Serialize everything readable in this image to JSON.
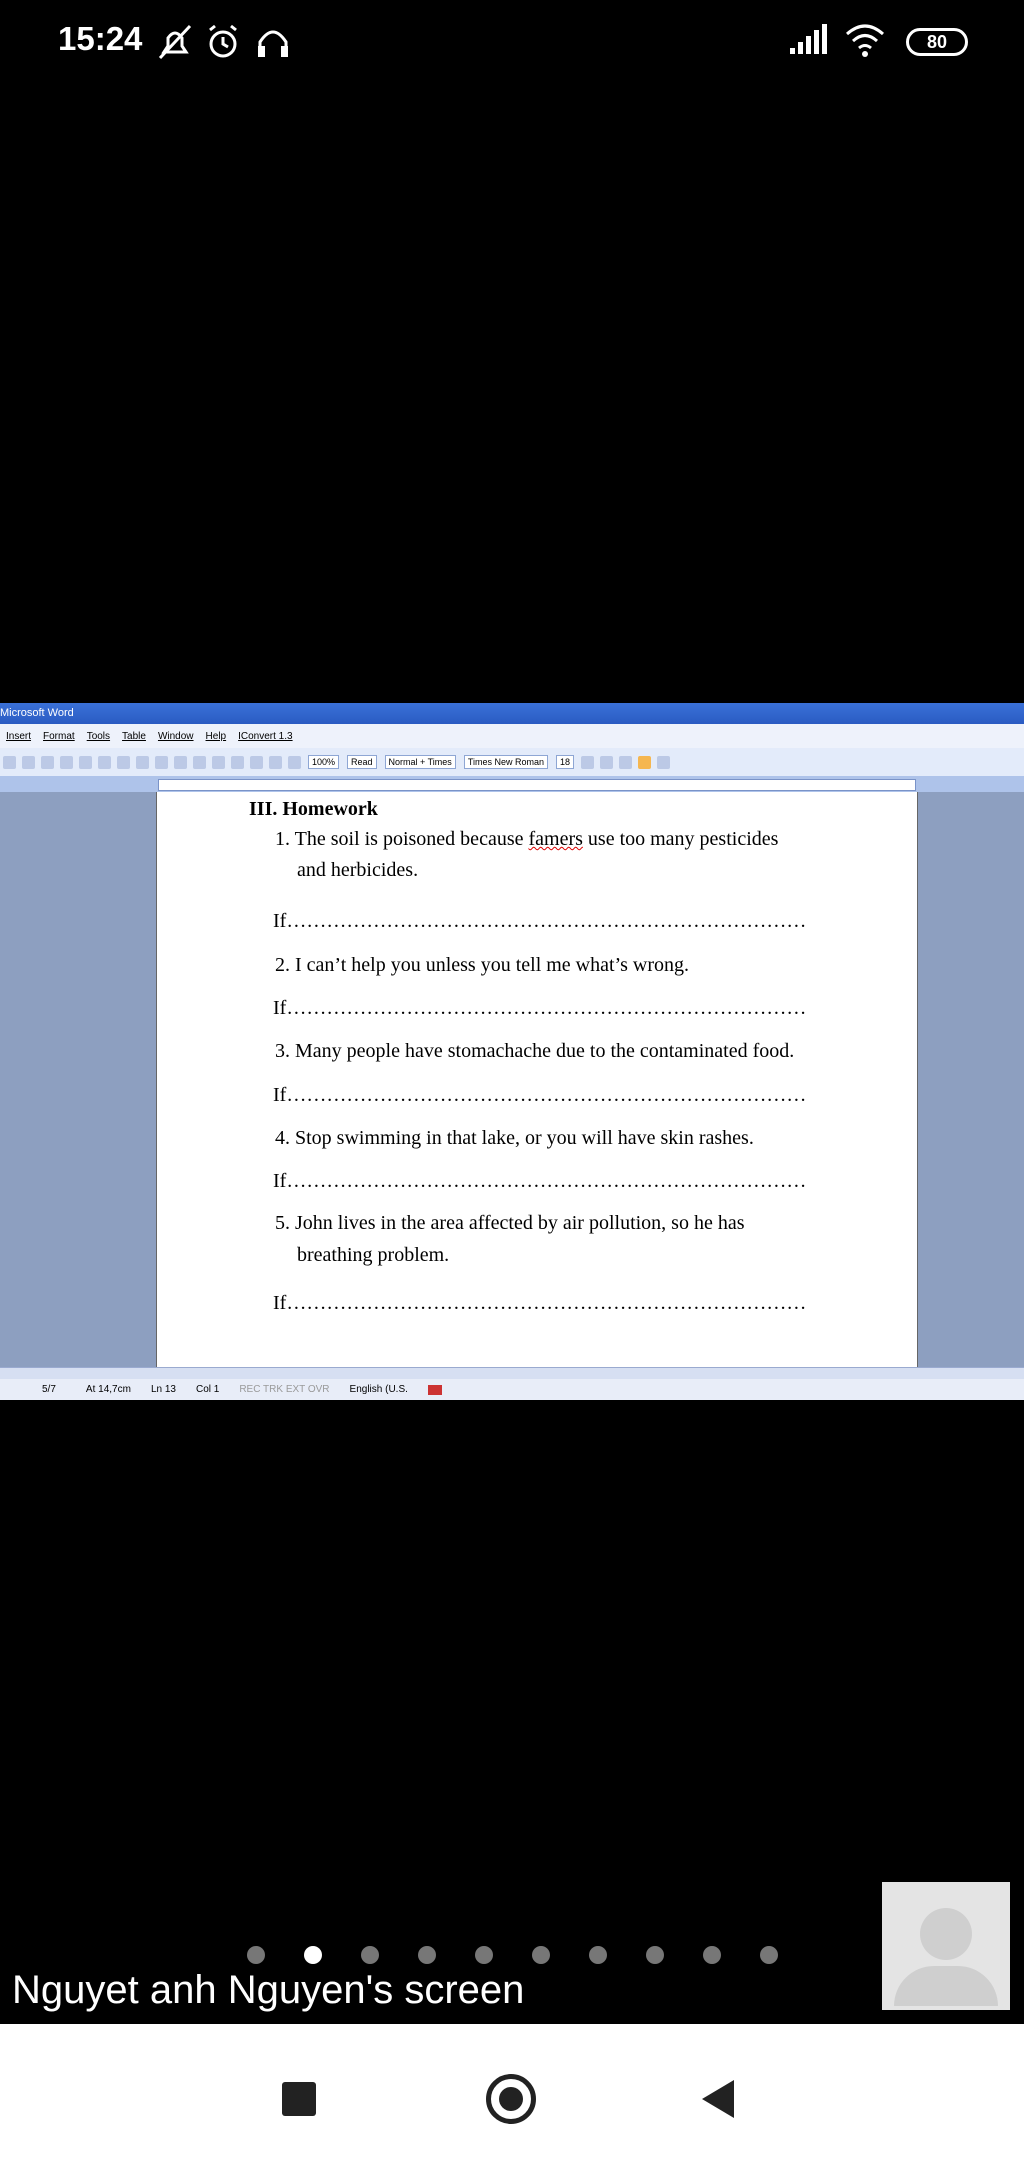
{
  "status_bar": {
    "time": "15:24",
    "battery": "80",
    "icons": [
      "silent-icon",
      "alarm-icon",
      "headphones-icon",
      "signal-icon",
      "wifi-icon",
      "battery-icon"
    ]
  },
  "word": {
    "title": "Microsoft Word",
    "menu": [
      "Insert",
      "Format",
      "Tools",
      "Table",
      "Window",
      "Help",
      "IConvert 1.3"
    ],
    "toolbar": {
      "zoom": "100%",
      "read": "Read",
      "style": "Normal + Times",
      "font": "Times New Roman",
      "size": "18"
    },
    "document": {
      "heading": "III. Homework",
      "items": [
        {
          "lines": [
            "1. The soil is poisoned because ",
            "famers",
            " use too many pesticides",
            "and herbicides."
          ]
        },
        {
          "lines": [
            "2. I can’t help you unless you tell me what’s wrong."
          ]
        },
        {
          "lines": [
            "3. Many people have stomachache due to the contaminated food."
          ]
        },
        {
          "lines": [
            "4. Stop swimming in that lake, or you will have skin rashes."
          ]
        },
        {
          "lines": [
            "5. John lives in the area affected by air pollution, so he has",
            "breathing problem."
          ]
        }
      ],
      "answer_prefix": "If",
      "answer_dots": "……………………………………………………………………"
    },
    "status": {
      "page": "5/7",
      "at": "At 14,7cm",
      "ln": "Ln 13",
      "col": "Col 1",
      "flags": "REC  TRK  EXT  OVR",
      "language": "English (U.S."
    }
  },
  "meeting": {
    "screen_label": "Nguyet anh Nguyen's screen",
    "pager_count": 10,
    "pager_active": 1
  }
}
